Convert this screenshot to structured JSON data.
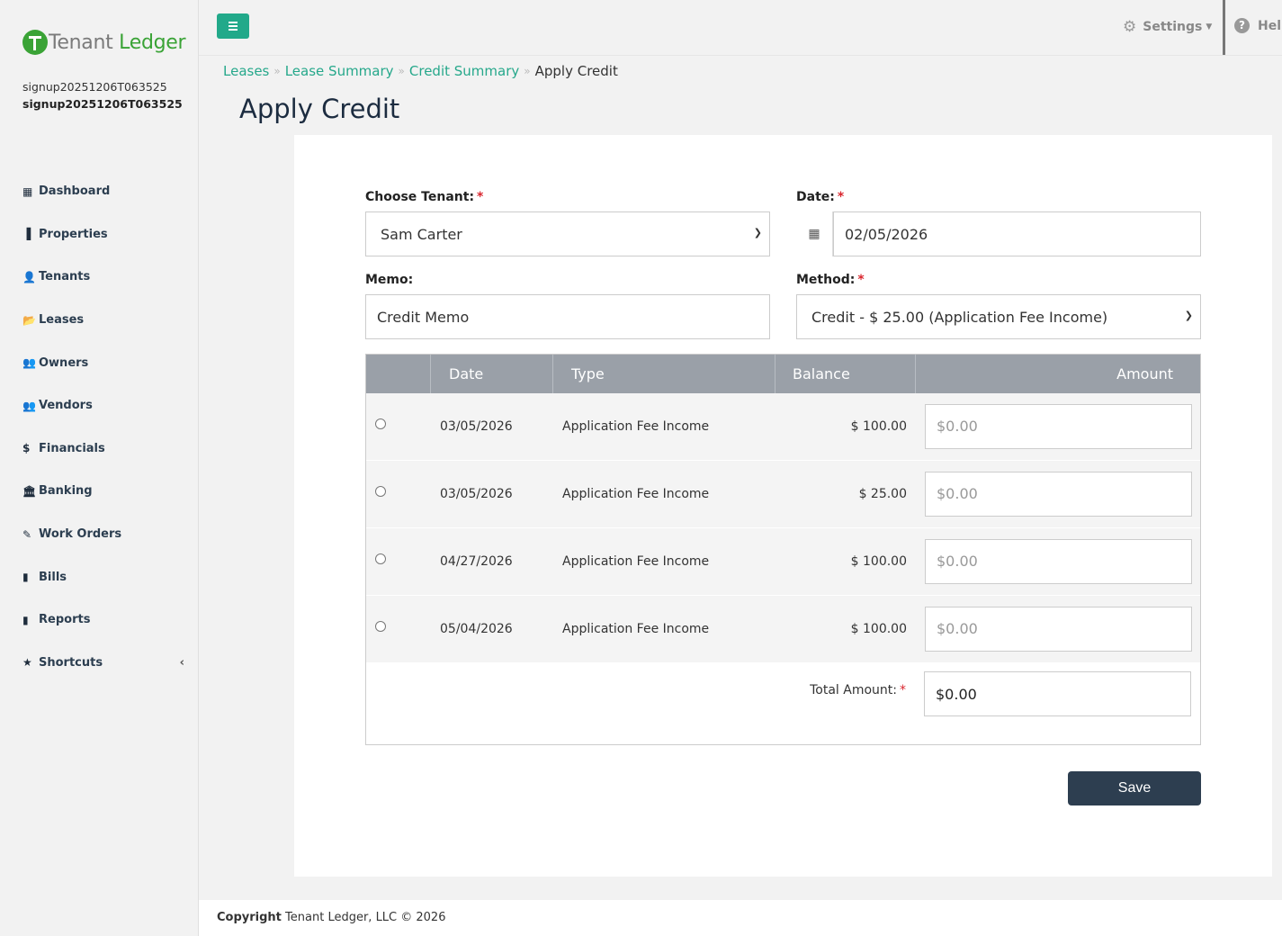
{
  "app": {
    "logo_part1": "Tenant",
    "logo_part2": "Ledger",
    "user_line1": "signup20251206T063525",
    "user_line2": "signup20251206T063525"
  },
  "sidebar": {
    "items": [
      {
        "label": "Dashboard",
        "icon": "▦"
      },
      {
        "label": "Properties",
        "icon": "▐"
      },
      {
        "label": "Tenants",
        "icon": "👤"
      },
      {
        "label": "Leases",
        "icon": "📂"
      },
      {
        "label": "Owners",
        "icon": "👥"
      },
      {
        "label": "Vendors",
        "icon": "👥"
      },
      {
        "label": "Financials",
        "icon": "$"
      },
      {
        "label": "Banking",
        "icon": "🏛"
      },
      {
        "label": "Work Orders",
        "icon": "✎"
      },
      {
        "label": "Bills",
        "icon": "▮"
      },
      {
        "label": "Reports",
        "icon": "▮"
      },
      {
        "label": "Shortcuts",
        "icon": "★",
        "chevron": "‹"
      }
    ]
  },
  "topbar": {
    "settings_label": "Settings",
    "help_label": "Help"
  },
  "breadcrumb": {
    "items": [
      "Leases",
      "Lease Summary",
      "Credit Summary"
    ],
    "current": "Apply Credit"
  },
  "page": {
    "title": "Apply Credit"
  },
  "form": {
    "tenant_label": "Choose Tenant:",
    "tenant_value": "Sam Carter",
    "date_label": "Date:",
    "date_value": "02/05/2026",
    "memo_label": "Memo:",
    "memo_value": "Credit Memo",
    "method_label": "Method:",
    "method_value": "Credit - $ 25.00 (Application Fee Income)",
    "required_mark": "*"
  },
  "table": {
    "headers": [
      "",
      "Date",
      "Type",
      "Balance",
      "Amount"
    ],
    "rows": [
      {
        "date": "03/05/2026",
        "type": "Application Fee Income",
        "balance": "$ 100.00",
        "amount_placeholder": "$0.00"
      },
      {
        "date": "03/05/2026",
        "type": "Application Fee Income",
        "balance": "$ 25.00",
        "amount_placeholder": "$0.00"
      },
      {
        "date": "04/27/2026",
        "type": "Application Fee Income",
        "balance": "$ 100.00",
        "amount_placeholder": "$0.00"
      },
      {
        "date": "05/04/2026",
        "type": "Application Fee Income",
        "balance": "$ 100.00",
        "amount_placeholder": "$0.00"
      }
    ],
    "total_label": "Total Amount:",
    "total_value": "$0.00"
  },
  "actions": {
    "save_label": "Save"
  },
  "footer": {
    "copyright_bold": "Copyright",
    "copyright_text": " Tenant Ledger, LLC © 2026"
  },
  "colors": {
    "accent": "#26a88b",
    "logo_green": "#3aa336",
    "header_gray": "#9aa0a8",
    "save_button": "#2d3e50",
    "required": "#d9262e"
  }
}
